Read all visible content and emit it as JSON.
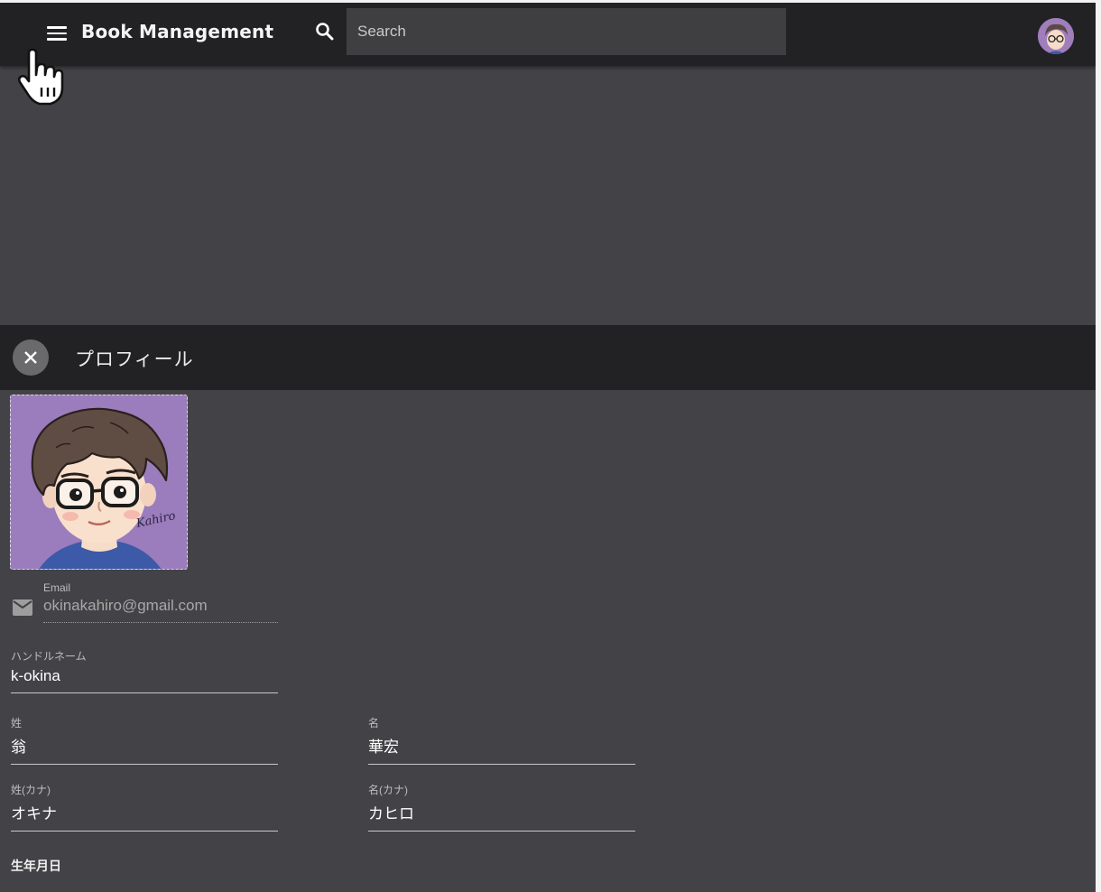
{
  "appbar": {
    "title": "Book Management",
    "search_placeholder": "Search"
  },
  "icons": {
    "menu": "menu-icon",
    "search": "search-icon",
    "avatar": "avatar",
    "close": "close-icon",
    "email": "email-icon",
    "cursor": "hand-pointer-icon"
  },
  "panel": {
    "title": "プロフィール",
    "image_signature": "Kahiro"
  },
  "form": {
    "email": {
      "label": "Email",
      "value": "okinakahiro@gmail.com"
    },
    "handle_name": {
      "label": "ハンドルネーム",
      "value": "k-okina"
    },
    "last_name": {
      "label": "姓",
      "value": "翁"
    },
    "first_name": {
      "label": "名",
      "value": "華宏"
    },
    "last_name_kana": {
      "label": "姓(カナ)",
      "value": "オキナ"
    },
    "first_name_kana": {
      "label": "名(カナ)",
      "value": "カヒロ"
    },
    "birthday": {
      "label": "生年月日"
    }
  },
  "colors": {
    "appbar_bg": "#222124",
    "page_bg": "#434246",
    "avatar_bg": "#9b7cbd",
    "close_button_bg": "#6a6a6d"
  }
}
